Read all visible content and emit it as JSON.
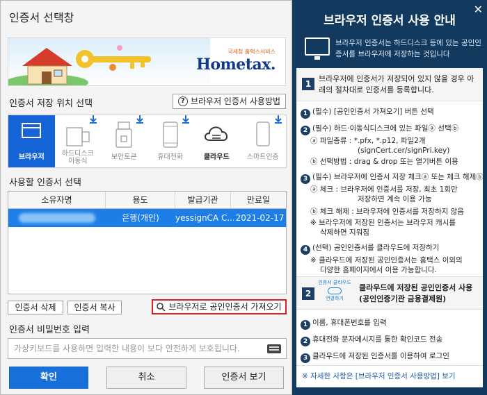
{
  "dialog": {
    "title": "인증서 선택창",
    "banner": {
      "logo_small": "국세청 홈택스서비스",
      "logo_main": "Hometax."
    },
    "storage_label": "인증서 저장 위치 선택",
    "help_button": "브라우저 인증서 사용방법",
    "locations": [
      {
        "label": "브라우저",
        "icon": "browser-icon",
        "active": true
      },
      {
        "label": "하드디스크\n이동식",
        "icon": "usb-drive-icon"
      },
      {
        "label": "보안토큰",
        "icon": "security-token-icon"
      },
      {
        "label": "휴대전화",
        "icon": "mobile-phone-icon"
      },
      {
        "label": "클라우드",
        "icon": "cloud-icon"
      },
      {
        "label": "스마트인증",
        "icon": "smart-auth-icon"
      }
    ],
    "cert_select_label": "사용할 인증서 선택",
    "table": {
      "columns": [
        "소유자명",
        "용도",
        "발급기관",
        "만료일"
      ],
      "rows": [
        {
          "owner": "",
          "usage": "은행(개인)",
          "issuer": "yessignCA C...",
          "expiry": "2021-02-17"
        }
      ]
    },
    "buttons": {
      "delete": "인증서 삭제",
      "copy": "인증서 복사",
      "import": "브라우저로 공인인증서 가져오기",
      "ok": "확인",
      "cancel": "취소",
      "view": "인증서 보기"
    },
    "password_label": "인증서 비밀번호 입력",
    "password_placeholder": "가상키보드를 사용하면 입력한 내용이 보다 안전하게 보호됩니다.",
    "accent_color": "#1870dc",
    "highlight_color": "#e02020"
  },
  "guide": {
    "title": "브라우저 인증서 사용 안내",
    "intro": "브라우저 인증서는 하드디스크 등에 있는 공인인증서를 브라우저에 저장하는 것입니다",
    "step1": {
      "num": "1",
      "text": "브라우저에 인증서가 저장되어 있지 않을 경우 아래의 절차대로 인증서를 등록합니다.",
      "items": [
        "(필수) [공인인증서 가져오기] 버튼 선택",
        "(필수) 하드·이동식디스크에 있는 파일ⓐ 선택ⓑ",
        "ⓐ 파일종류 : *.pfx, *.p12, 파일2개",
        "(signCert.cer/signPri.key)",
        "ⓑ 선택방법 : drag & drop 또는 열기버튼 이용",
        "(필수) 브라우저에 인증서 저장 체크ⓐ 또는 체크 해제ⓑ",
        "ⓐ 체크 :  브라우저에 인증서를 저장, 최초 1회만",
        "저장하면 계속 이용 가능",
        "ⓑ 체크 해제 : 브라우저에 인증서를 저장하지 않음",
        "※ 브라우저에 저장된 인증서는 브라우저 캐시를",
        "삭제하면 지워짐",
        "(선택) 공인인증서를 클라우드에 저장하기",
        "※ 클라우드에 저장된 공인인증서는 홈택스 이외의",
        "다양한 홈페이지에서 이용 가능합니다."
      ]
    },
    "step2": {
      "num": "2",
      "badge_top": "인증서 클라우드",
      "badge_bottom": "연결하기",
      "text": "클라우드에 저장된 공인인증서 사용 (공인인증기관 금융결제원)",
      "items": [
        "이름, 휴대폰번호를 입력",
        "휴대전화 문자메시지를 통한 확인코드 전송",
        "클라우드에 저장된 인증서를 이용하여 로그인"
      ]
    },
    "footer": "※ 자세한 사항은 [브라우저 인증서 사용방법] 보기",
    "close": "✕",
    "bg_color": "#123a5f"
  }
}
